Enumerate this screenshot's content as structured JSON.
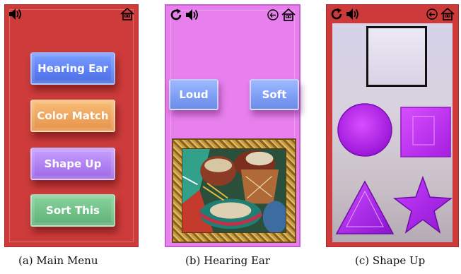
{
  "panels": [
    {
      "caption": "(a) Main Menu",
      "menu_buttons": [
        "Hearing Ear",
        "Color Match",
        "Shape Up",
        "Sort This"
      ]
    },
    {
      "caption": "(b) Hearing Ear",
      "buttons": [
        "Loud",
        "Soft"
      ],
      "image": "drums-photo"
    },
    {
      "caption": "(c) Shape Up",
      "shapes": [
        "square-target",
        "circle",
        "square",
        "triangle",
        "star"
      ]
    }
  ],
  "icons": {
    "sound": "speaker-icon",
    "home": "home-icon",
    "replay": "refresh-icon",
    "back": "back-icon"
  },
  "colors": {
    "menu_background": "#cd3b3b",
    "hearing_background": "#e77fec",
    "shape_color": "#c22cff"
  }
}
